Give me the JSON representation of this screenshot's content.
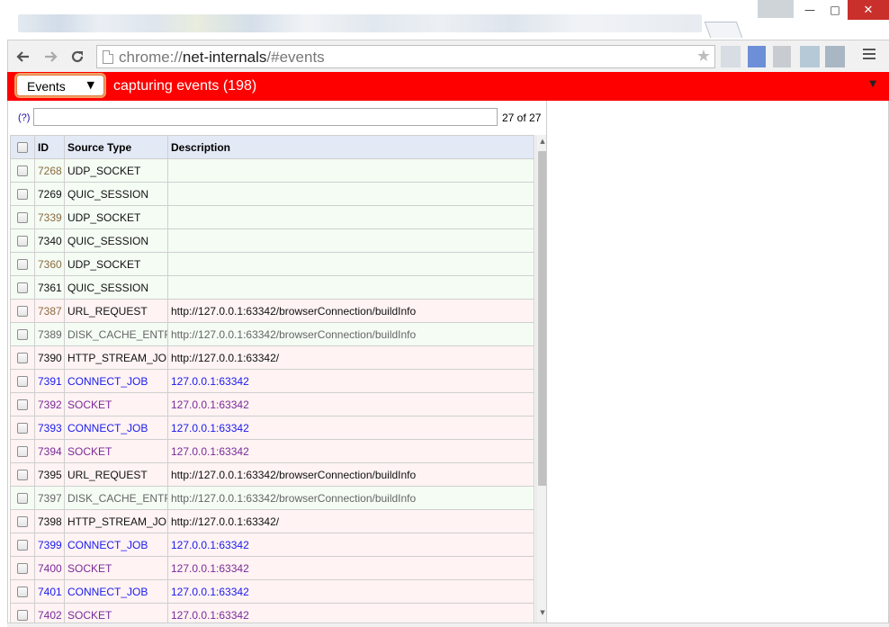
{
  "browser": {
    "url_scheme": "chrome://",
    "url_host": "net-internals",
    "url_path": "/#events",
    "window_buttons": {
      "minimize": "—",
      "maximize": "□",
      "close": "✕"
    }
  },
  "statusbar": {
    "tab_select": "Events",
    "status_text": "capturing events (198)",
    "color": "#ff0000"
  },
  "filter": {
    "help": "(?)",
    "value": "",
    "count": "27 of 27"
  },
  "table": {
    "headers": {
      "id": "ID",
      "source_type": "Source Type",
      "description": "Description"
    },
    "rows": [
      {
        "id": "7268",
        "source_type": "UDP_SOCKET",
        "description": "",
        "bg": "green",
        "color": "default"
      },
      {
        "id": "7269",
        "source_type": "QUIC_SESSION",
        "description": "",
        "bg": "green",
        "color": "black"
      },
      {
        "id": "7339",
        "source_type": "UDP_SOCKET",
        "description": "",
        "bg": "green",
        "color": "default"
      },
      {
        "id": "7340",
        "source_type": "QUIC_SESSION",
        "description": "",
        "bg": "green",
        "color": "black"
      },
      {
        "id": "7360",
        "source_type": "UDP_SOCKET",
        "description": "",
        "bg": "green",
        "color": "default"
      },
      {
        "id": "7361",
        "source_type": "QUIC_SESSION",
        "description": "",
        "bg": "green",
        "color": "black"
      },
      {
        "id": "7387",
        "source_type": "URL_REQUEST",
        "description": "http://127.0.0.1:63342/browserConnection/buildInfo",
        "bg": "pink",
        "color": "default"
      },
      {
        "id": "7389",
        "source_type": "DISK_CACHE_ENTRY",
        "description": "http://127.0.0.1:63342/browserConnection/buildInfo",
        "bg": "green",
        "color": "gray"
      },
      {
        "id": "7390",
        "source_type": "HTTP_STREAM_JOB",
        "description": "http://127.0.0.1:63342/",
        "bg": "pink",
        "color": "black"
      },
      {
        "id": "7391",
        "source_type": "CONNECT_JOB",
        "description": "127.0.0.1:63342",
        "bg": "pink",
        "color": "blue"
      },
      {
        "id": "7392",
        "source_type": "SOCKET",
        "description": "127.0.0.1:63342",
        "bg": "pink",
        "color": "purple"
      },
      {
        "id": "7393",
        "source_type": "CONNECT_JOB",
        "description": "127.0.0.1:63342",
        "bg": "pink",
        "color": "blue"
      },
      {
        "id": "7394",
        "source_type": "SOCKET",
        "description": "127.0.0.1:63342",
        "bg": "pink",
        "color": "purple"
      },
      {
        "id": "7395",
        "source_type": "URL_REQUEST",
        "description": "http://127.0.0.1:63342/browserConnection/buildInfo",
        "bg": "pink",
        "color": "black"
      },
      {
        "id": "7397",
        "source_type": "DISK_CACHE_ENTRY",
        "description": "http://127.0.0.1:63342/browserConnection/buildInfo",
        "bg": "green",
        "color": "gray"
      },
      {
        "id": "7398",
        "source_type": "HTTP_STREAM_JOB",
        "description": "http://127.0.0.1:63342/",
        "bg": "pink",
        "color": "black"
      },
      {
        "id": "7399",
        "source_type": "CONNECT_JOB",
        "description": "127.0.0.1:63342",
        "bg": "pink",
        "color": "blue"
      },
      {
        "id": "7400",
        "source_type": "SOCKET",
        "description": "127.0.0.1:63342",
        "bg": "pink",
        "color": "purple"
      },
      {
        "id": "7401",
        "source_type": "CONNECT_JOB",
        "description": "127.0.0.1:63342",
        "bg": "pink",
        "color": "blue"
      },
      {
        "id": "7402",
        "source_type": "SOCKET",
        "description": "127.0.0.1:63342",
        "bg": "pink",
        "color": "purple"
      }
    ]
  },
  "icons": {
    "back": "back-arrow-icon",
    "forward": "forward-arrow-icon",
    "reload": "reload-icon",
    "page": "page-icon",
    "bookmark": "star-icon",
    "menu": "hamburger-menu-icon",
    "dropdown": "dropdown-arrow-icon",
    "status_menu": "triangle-down-icon"
  }
}
